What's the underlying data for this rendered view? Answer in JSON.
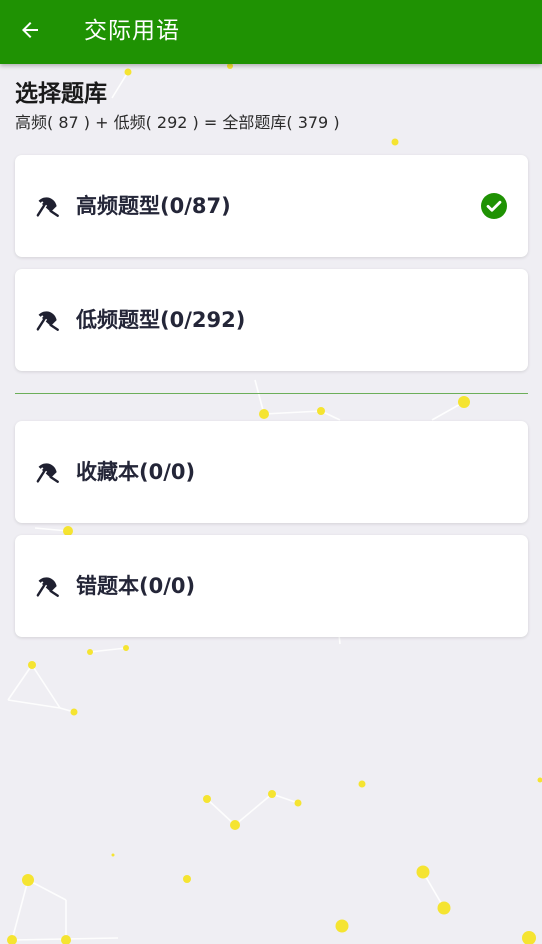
{
  "header": {
    "title": "交际用语",
    "back_icon": "arrow-left-icon",
    "bar_color": "#1f9203"
  },
  "bank": {
    "heading": "选择题库",
    "summary": "高频( 87 ) + 低频( 292 ) = 全部题库( 379 )"
  },
  "cards": [
    {
      "label": "高频题型(0/87)",
      "icon": "umbrella-icon",
      "selected": true
    },
    {
      "label": "低频题型(0/292)",
      "icon": "umbrella-icon",
      "selected": false
    },
    {
      "label": "收藏本(0/0)",
      "icon": "umbrella-icon",
      "selected": false
    },
    {
      "label": "错题本(0/0)",
      "icon": "umbrella-icon",
      "selected": false
    }
  ],
  "colors": {
    "accent": "#1f9203",
    "check": "#1f9203",
    "divider": "#6cae59",
    "particle": "#f5e431",
    "background": "#efeef3"
  }
}
